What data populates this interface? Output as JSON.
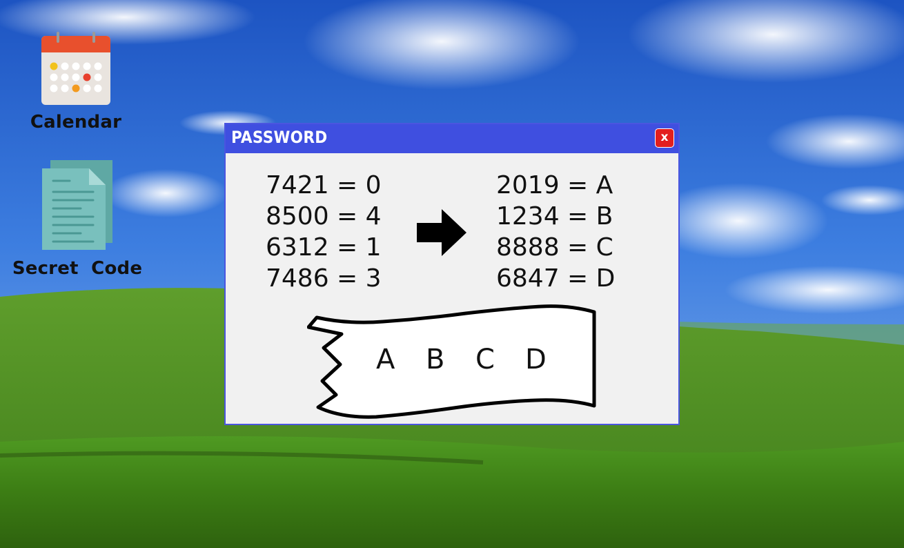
{
  "desktop": {
    "icons": [
      {
        "id": "calendar",
        "label": "Calendar",
        "icon": "calendar-icon"
      },
      {
        "id": "secret-code",
        "label": "Secret  Code",
        "icon": "document-icon"
      }
    ]
  },
  "dialog": {
    "title": "PASSWORD",
    "close_label": "x",
    "clues_left": [
      "7421 = 0",
      "8500 = 4",
      "6312 = 1",
      "7486 = 3"
    ],
    "arrow_icon": "arrow-right-icon",
    "clues_right": [
      "2019 = A",
      "1234 = B",
      "8888 = C",
      "6847 = D"
    ],
    "code_letters": [
      "A",
      "B",
      "C",
      "D"
    ]
  },
  "colors": {
    "titlebar": "#3f4fe0",
    "close_button": "#e31e1e",
    "dialog_background": "#f1f1f1",
    "calendar_header": "#e8502d",
    "document": "#79c0bd"
  }
}
